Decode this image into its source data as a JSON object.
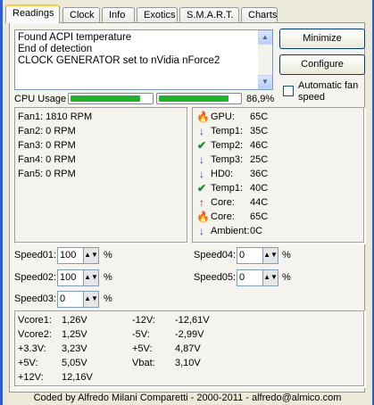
{
  "tabs": [
    "Readings",
    "Clock",
    "Info",
    "Exotics",
    "S.M.A.R.T.",
    "Charts"
  ],
  "log": [
    "Found ACPI temperature",
    "End of detection",
    "CLOCK GENERATOR set to nVidia nForce2"
  ],
  "buttons": {
    "minimize": "Minimize",
    "configure": "Configure"
  },
  "auto_fan": {
    "label": "Automatic fan speed",
    "checked": false
  },
  "cpu": {
    "label": "CPU Usage",
    "value_text": "86,9%",
    "value": 0.869
  },
  "fans": [
    "Fan1: 1810 RPM",
    "Fan2: 0 RPM",
    "Fan3: 0 RPM",
    "Fan4: 0 RPM",
    "Fan5: 0 RPM"
  ],
  "temps": [
    {
      "icon": "flame-icon",
      "color": "#e03010",
      "label": "GPU:",
      "value": "65C"
    },
    {
      "icon": "down-arrow-icon",
      "color": "#1a3ec8",
      "label": "Temp1:",
      "value": "35C"
    },
    {
      "icon": "checkmark-icon",
      "color": "#109020",
      "label": "Temp2:",
      "value": "46C"
    },
    {
      "icon": "down-arrow-icon",
      "color": "#1a3ec8",
      "label": "Temp3:",
      "value": "25C"
    },
    {
      "icon": "down-arrow-icon",
      "color": "#1a3ec8",
      "label": "HD0:",
      "value": "36C"
    },
    {
      "icon": "checkmark-icon",
      "color": "#109020",
      "label": "Temp1:",
      "value": "40C"
    },
    {
      "icon": "up-arrow-icon",
      "color": "#d01010",
      "label": "Core:",
      "value": "44C"
    },
    {
      "icon": "flame-icon",
      "color": "#e03010",
      "label": "Core:",
      "value": "65C"
    },
    {
      "icon": "down-arrow-icon",
      "color": "#1a3ec8",
      "label": "Ambient:",
      "value": "0C"
    }
  ],
  "speeds": {
    "speed01": {
      "label": "Speed01:",
      "value": "100",
      "unit": "%"
    },
    "speed02": {
      "label": "Speed02:",
      "value": "100",
      "unit": "%"
    },
    "speed03": {
      "label": "Speed03:",
      "value": "0",
      "unit": "%"
    },
    "speed04": {
      "label": "Speed04:",
      "value": "0",
      "unit": "%"
    },
    "speed05": {
      "label": "Speed05:",
      "value": "0",
      "unit": "%"
    }
  },
  "voltages_left": [
    {
      "label": "Vcore1:",
      "value": "1,26V"
    },
    {
      "label": "Vcore2:",
      "value": "1,25V"
    },
    {
      "label": "+3.3V:",
      "value": "3,23V"
    },
    {
      "label": "+5V:",
      "value": "5,05V"
    },
    {
      "label": "+12V:",
      "value": "12,16V"
    }
  ],
  "voltages_right": [
    {
      "label": "-12V:",
      "value": "-12,61V"
    },
    {
      "label": "-5V:",
      "value": "-2,99V"
    },
    {
      "label": "+5V:",
      "value": "4,87V"
    },
    {
      "label": "Vbat:",
      "value": "3,10V"
    }
  ],
  "footer": "Coded by Alfredo Milani Comparetti - 2000-2011 - alfredo@almico.com"
}
